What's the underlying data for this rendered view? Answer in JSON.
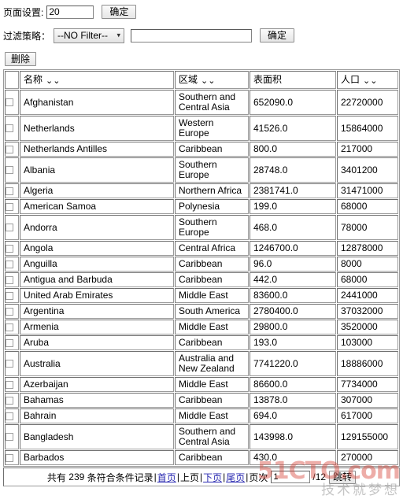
{
  "toolbar": {
    "page_size_label": "页面设置:",
    "page_size_value": "20",
    "page_size_submit": "确定",
    "filter_label": "过滤策略：",
    "filter_selected": "--NO Filter--",
    "filter_options": [
      "--NO Filter--"
    ],
    "filter_text_value": "",
    "filter_submit": "确定",
    "delete_label": "删除"
  },
  "table": {
    "columns": [
      {
        "key": "checkbox",
        "label": "",
        "sortable": false
      },
      {
        "key": "name",
        "label": "名称",
        "sortable": true
      },
      {
        "key": "region",
        "label": "区域",
        "sortable": true
      },
      {
        "key": "area",
        "label": "表面积",
        "sortable": false
      },
      {
        "key": "population",
        "label": "人口",
        "sortable": true
      }
    ],
    "sort_icon": "⌄⌄",
    "rows": [
      {
        "name": "Afghanistan",
        "region": "Southern and Central Asia",
        "area": "652090.0",
        "population": "22720000"
      },
      {
        "name": "Netherlands",
        "region": "Western Europe",
        "area": "41526.0",
        "population": "15864000"
      },
      {
        "name": "Netherlands Antilles",
        "region": "Caribbean",
        "area": "800.0",
        "population": "217000"
      },
      {
        "name": "Albania",
        "region": "Southern Europe",
        "area": "28748.0",
        "population": "3401200"
      },
      {
        "name": "Algeria",
        "region": "Northern Africa",
        "area": "2381741.0",
        "population": "31471000"
      },
      {
        "name": "American Samoa",
        "region": "Polynesia",
        "area": "199.0",
        "population": "68000"
      },
      {
        "name": "Andorra",
        "region": "Southern Europe",
        "area": "468.0",
        "population": "78000"
      },
      {
        "name": "Angola",
        "region": "Central Africa",
        "area": "1246700.0",
        "population": "12878000"
      },
      {
        "name": "Anguilla",
        "region": "Caribbean",
        "area": "96.0",
        "population": "8000"
      },
      {
        "name": "Antigua and Barbuda",
        "region": "Caribbean",
        "area": "442.0",
        "population": "68000"
      },
      {
        "name": "United Arab Emirates",
        "region": "Middle East",
        "area": "83600.0",
        "population": "2441000"
      },
      {
        "name": "Argentina",
        "region": "South America",
        "area": "2780400.0",
        "population": "37032000"
      },
      {
        "name": "Armenia",
        "region": "Middle East",
        "area": "29800.0",
        "population": "3520000"
      },
      {
        "name": "Aruba",
        "region": "Caribbean",
        "area": "193.0",
        "population": "103000"
      },
      {
        "name": "Australia",
        "region": "Australia and New Zealand",
        "area": "7741220.0",
        "population": "18886000"
      },
      {
        "name": "Azerbaijan",
        "region": "Middle East",
        "area": "86600.0",
        "population": "7734000"
      },
      {
        "name": "Bahamas",
        "region": "Caribbean",
        "area": "13878.0",
        "population": "307000"
      },
      {
        "name": "Bahrain",
        "region": "Middle East",
        "area": "694.0",
        "population": "617000"
      },
      {
        "name": "Bangladesh",
        "region": "Southern and Central Asia",
        "area": "143998.0",
        "population": "129155000"
      },
      {
        "name": "Barbados",
        "region": "Caribbean",
        "area": "430.0",
        "population": "270000"
      }
    ]
  },
  "footer": {
    "total_prefix": "共有",
    "total_count": "239",
    "total_suffix": "条符合条件记录",
    "separator": "|",
    "first_page": "首页",
    "prev_page": "上页",
    "next_page": "下页",
    "last_page": "尾页",
    "page_label": "页次",
    "current_page": "1",
    "page_of": "/12",
    "jump_label": "跳转"
  },
  "watermark": {
    "main": "51CTO.com",
    "sub": "技术就梦想"
  }
}
